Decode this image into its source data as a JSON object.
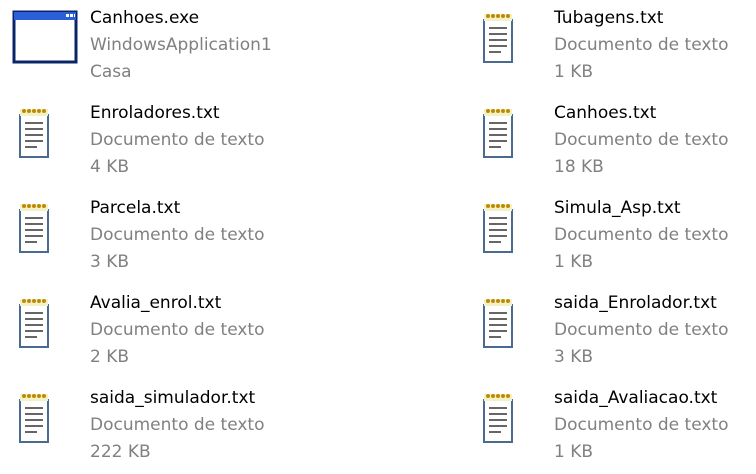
{
  "files": [
    {
      "name": "Canhoes.exe",
      "line2": "WindowsApplication1",
      "line3": "Casa",
      "icon": "application-window-icon"
    },
    {
      "name": "Tubagens.txt",
      "line2": "Documento de texto",
      "line3": "1 KB",
      "icon": "text-document-icon"
    },
    {
      "name": "Enroladores.txt",
      "line2": "Documento de texto",
      "line3": "4 KB",
      "icon": "text-document-icon"
    },
    {
      "name": "Canhoes.txt",
      "line2": "Documento de texto",
      "line3": "18 KB",
      "icon": "text-document-icon"
    },
    {
      "name": "Parcela.txt",
      "line2": "Documento de texto",
      "line3": "3 KB",
      "icon": "text-document-icon"
    },
    {
      "name": "Simula_Asp.txt",
      "line2": "Documento de texto",
      "line3": "1 KB",
      "icon": "text-document-icon"
    },
    {
      "name": "Avalia_enrol.txt",
      "line2": "Documento de texto",
      "line3": "2 KB",
      "icon": "text-document-icon"
    },
    {
      "name": "saida_Enrolador.txt",
      "line2": "Documento de texto",
      "line3": "3 KB",
      "icon": "text-document-icon"
    },
    {
      "name": "saida_simulador.txt",
      "line2": "Documento de texto",
      "line3": "222 KB",
      "icon": "text-document-icon"
    },
    {
      "name": "saida_Avaliacao.txt",
      "line2": "Documento de texto",
      "line3": "1 KB",
      "icon": "text-document-icon"
    }
  ]
}
